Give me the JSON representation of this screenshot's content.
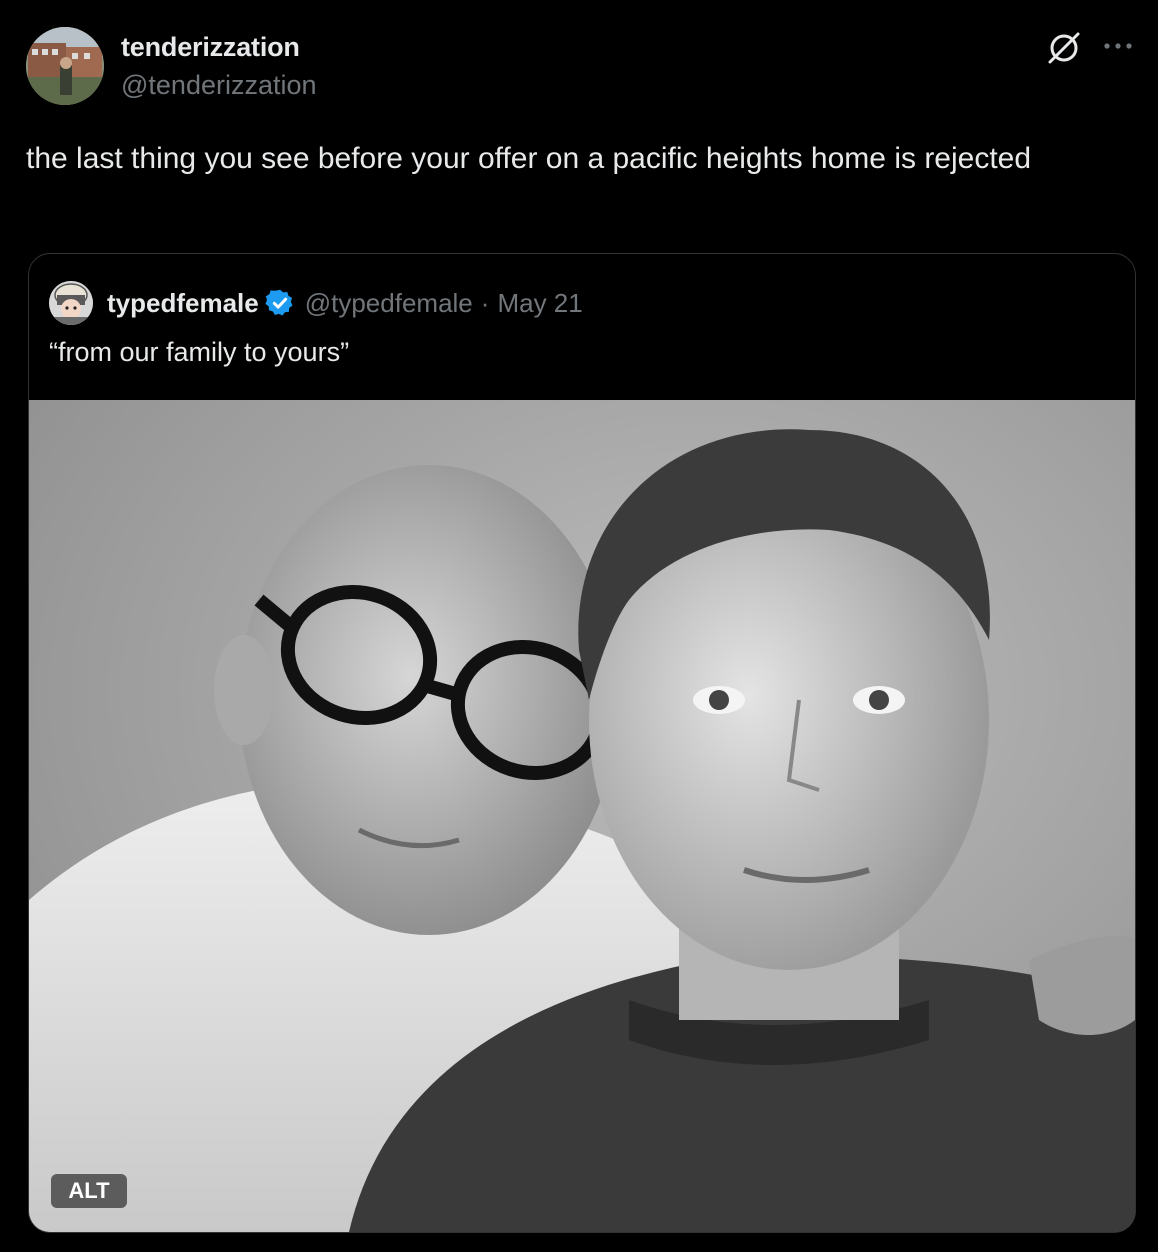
{
  "tweet": {
    "author": {
      "display_name": "tenderizzation",
      "handle": "@tenderizzation",
      "avatar_icon": "avatar-photo"
    },
    "text": "the last thing you see before your offer on a pacific heights home is rejected",
    "actions": {
      "grok_icon": "grok-icon",
      "more_icon": "more-icon"
    }
  },
  "quoted_tweet": {
    "author": {
      "display_name": "typedfemale",
      "verified": true,
      "handle": "@typedfemale",
      "separator": "·",
      "date": "May 21"
    },
    "text": "“from our family to yours”",
    "media": {
      "alt_label": "ALT"
    }
  },
  "colors": {
    "background": "#000000",
    "primary_text": "#e7e9ea",
    "secondary_text": "#71767b",
    "border": "#2f3336",
    "verified_blue": "#1d9bf0"
  }
}
